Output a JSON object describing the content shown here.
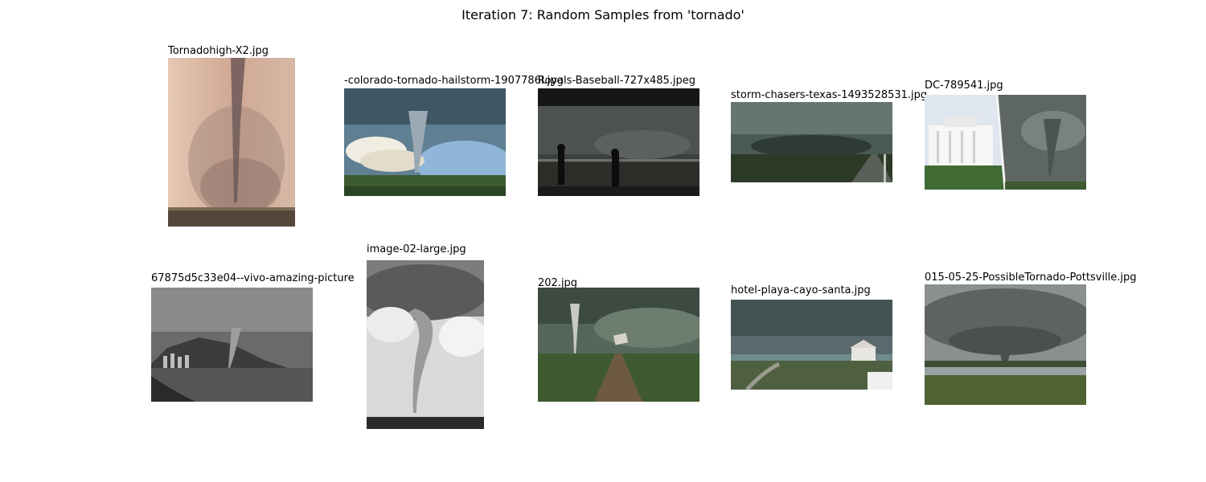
{
  "title": "Iteration 7: Random Samples from 'tornado'",
  "samples": [
    {
      "filename": "Tornadohigh-X2.jpg",
      "scene": "tornado-funnel-dusty-pink"
    },
    {
      "filename": "-colorado-tornado-hailstorm-1907786l.jpg",
      "scene": "tornado-funnel-blue-sky"
    },
    {
      "filename": "Royals-Baseball-727x485.jpeg",
      "scene": "storm-spectators-silhouettes"
    },
    {
      "filename": "storm-chasers-texas-1493528531.jpg",
      "scene": "wall-cloud-highway"
    },
    {
      "filename": "DC-789541.jpg",
      "scene": "white-house-tornado-composite"
    },
    {
      "filename": "67875d5c33e04--vivo-amazing-picture",
      "scene": "waterspout-coastal-city"
    },
    {
      "filename": "image-02-large.jpg",
      "scene": "tornado-black-and-white"
    },
    {
      "filename": "202.jpg",
      "scene": "tornado-dirt-road-field"
    },
    {
      "filename": "hotel-playa-cayo-santa.jpg",
      "scene": "beach-storm-gazebo"
    },
    {
      "filename": "015-05-25-PossibleTornado-Pottsville.jpg",
      "scene": "supercell-over-field"
    }
  ]
}
